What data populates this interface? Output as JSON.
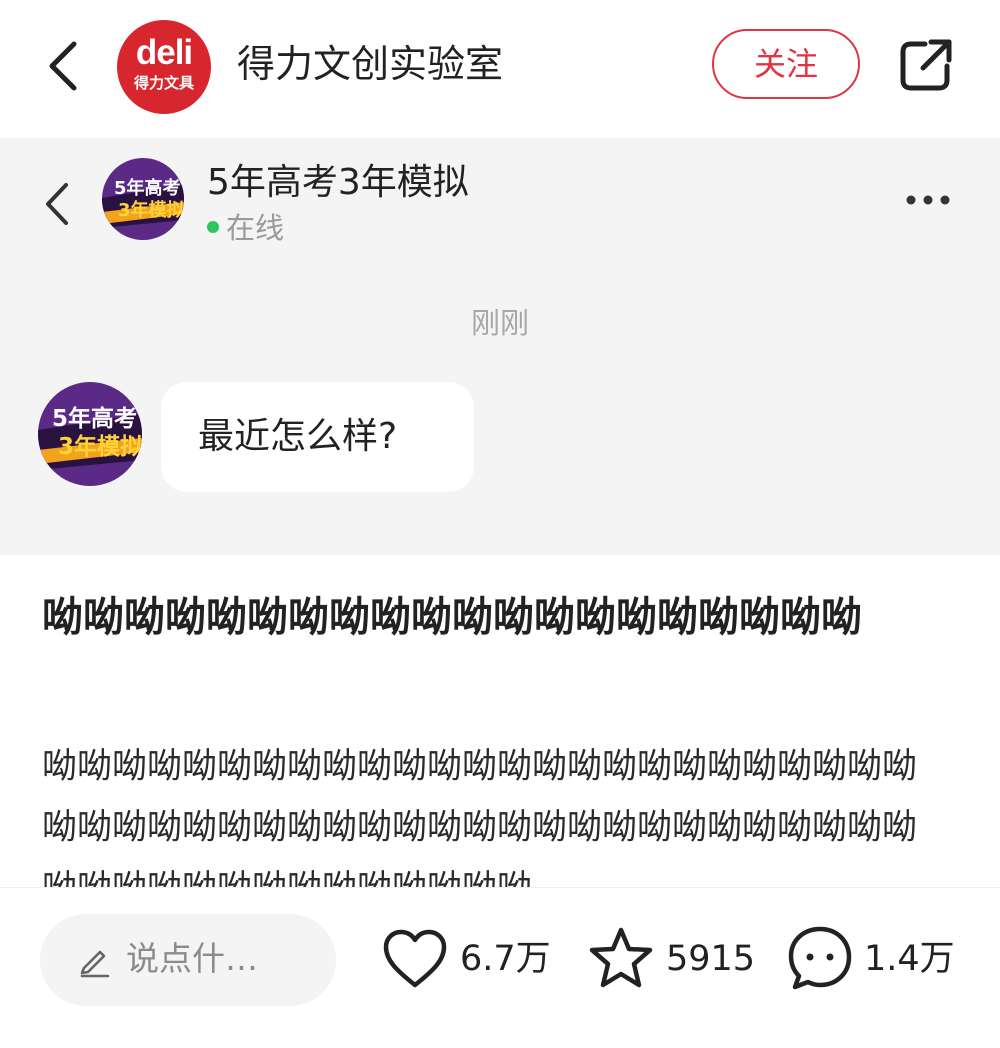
{
  "header": {
    "logo_text": "deli",
    "logo_subtext": "得力文具",
    "account_name": "得力文创实验室",
    "follow_label": "关注"
  },
  "chat": {
    "contact_name": "5年高考3年模拟",
    "status": "在线",
    "avatar_text_top": "5年高考",
    "avatar_text_bottom": "3年模拟",
    "timestamp": "刚刚",
    "message": "最近怎么样?"
  },
  "post": {
    "title": "呦呦呦呦呦呦呦呦呦呦呦呦呦呦呦呦呦呦呦呦",
    "body": "呦呦呦呦呦呦呦呦呦呦呦呦呦呦呦呦呦呦呦呦呦呦呦呦呦呦呦呦呦呦呦呦呦呦呦呦呦呦呦呦呦呦呦呦呦呦呦呦呦呦呦呦呦呦呦呦呦呦呦呦呦呦呦呦"
  },
  "bottom_bar": {
    "comment_placeholder": "说点什…",
    "likes": "6.7万",
    "favorites": "5915",
    "comments": "1.4万"
  },
  "colors": {
    "brand_red": "#d8262e",
    "follow_red": "#e23344",
    "online_green": "#2ec55c",
    "chat_bg": "#f4f4f4"
  },
  "icons": [
    "back-arrow-icon",
    "share-icon",
    "more-icon",
    "pencil-icon",
    "heart-icon",
    "star-icon",
    "comment-bubble-icon"
  ]
}
